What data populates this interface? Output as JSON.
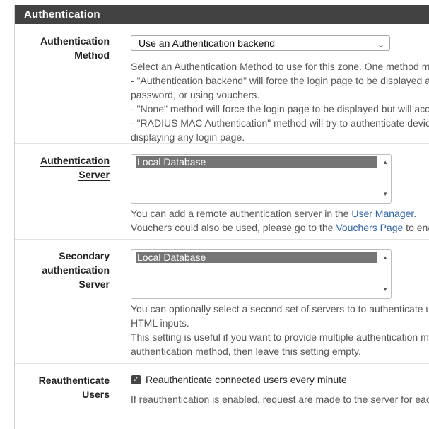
{
  "panel": {
    "title": "Authentication"
  },
  "auth_method": {
    "label_line1": "Authentication",
    "label_line2": "Method",
    "selected": "Use an Authentication backend",
    "help": [
      "Select an Authentication Method to use for this zone. One method m",
      "- \"Authentication backend\" will force the login page to be displayed a",
      "password, or using vouchers.",
      "- \"None\" method will force the login page to be displayed but will acc",
      "- \"RADIUS MAC Authentication\" method will try to authenticate device",
      "displaying any login page."
    ]
  },
  "auth_server": {
    "label_line1": "Authentication",
    "label_line2": "Server",
    "option": "Local Database",
    "help1_pre": "You can add a remote authentication server in the ",
    "help1_link": "User Manager",
    "help1_post": ".",
    "help2_pre": "Vouchers could also be used, please go to the ",
    "help2_link": "Vouchers Page",
    "help2_post": " to ena"
  },
  "secondary_server": {
    "label_line1": "Secondary",
    "label_line2": "authentication",
    "label_line3": "Server",
    "option": "Local Database",
    "help": [
      "You can optionally select a second set of servers to to authenticate u",
      "HTML inputs.",
      "This setting is useful if you want to provide multiple authentication m",
      "authentication method, then leave this setting empty."
    ]
  },
  "reauth": {
    "label_line1": "Reauthenticate",
    "label_line2": "Users",
    "checkbox_label": "Reauthenticate connected users every minute",
    "checked": true,
    "help": "If reauthentication is enabled, request are made to the server for eac"
  }
}
